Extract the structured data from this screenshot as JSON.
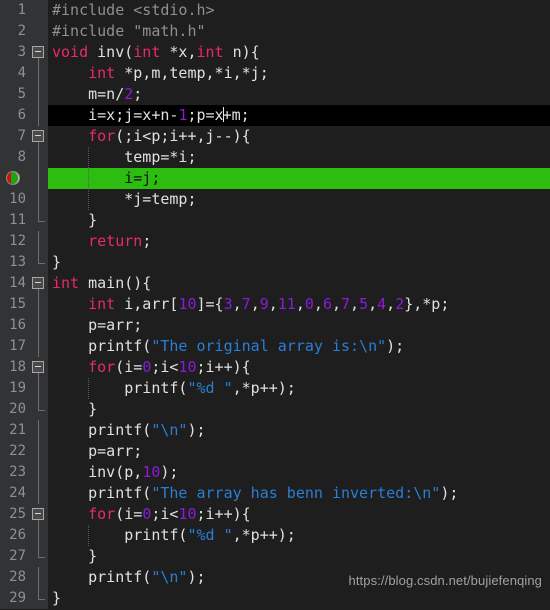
{
  "editor": {
    "language": "C",
    "theme": "dark",
    "colors": {
      "background": "#1e1e1e",
      "gutter_background": "#313335",
      "line_number": "#8a9199",
      "keyword": "#e8296d",
      "number": "#8c1ad9",
      "string": "#2a7ed6",
      "preprocessor": "#8f8f8f",
      "plain_text": "#e0e0e0",
      "current_line": "#000000",
      "execution_line": "#2dbd10"
    },
    "current_line_number": 6,
    "execution_line_number": 9,
    "breakpoint_line_number": 9,
    "caret": {
      "line": 6,
      "after_text": "i=x;j=x+n-1;p=x"
    }
  },
  "watermark": "https://blog.csdn.net/bujiefenqing",
  "lines": [
    {
      "n": "1",
      "indent": 0,
      "fold": "",
      "tokens": [
        {
          "t": "pre",
          "v": "#include <stdio.h>"
        }
      ]
    },
    {
      "n": "2",
      "indent": 0,
      "fold": "",
      "tokens": [
        {
          "t": "pre",
          "v": "#include \"math.h\""
        }
      ]
    },
    {
      "n": "3",
      "indent": 0,
      "fold": "box",
      "tokens": [
        {
          "t": "kw",
          "v": "void"
        },
        {
          "t": "plain",
          "v": " inv("
        },
        {
          "t": "kw",
          "v": "int"
        },
        {
          "t": "plain",
          "v": " *x,"
        },
        {
          "t": "kw",
          "v": "int"
        },
        {
          "t": "plain",
          "v": " n){"
        }
      ]
    },
    {
      "n": "4",
      "indent": 1,
      "fold": "line",
      "tokens": [
        {
          "t": "plain",
          "v": "    "
        },
        {
          "t": "kw",
          "v": "int"
        },
        {
          "t": "plain",
          "v": " *p,m,temp,*i,*j;"
        }
      ]
    },
    {
      "n": "5",
      "indent": 1,
      "fold": "line",
      "tokens": [
        {
          "t": "plain",
          "v": "    m=n/"
        },
        {
          "t": "num",
          "v": "2"
        },
        {
          "t": "plain",
          "v": ";"
        }
      ]
    },
    {
      "n": "6",
      "indent": 1,
      "fold": "line",
      "tokens": [
        {
          "t": "plain",
          "v": "    i=x;j=x+n-"
        },
        {
          "t": "num",
          "v": "1"
        },
        {
          "t": "plain",
          "v": ";p=x"
        },
        {
          "t": "caret",
          "v": ""
        },
        {
          "t": "plain",
          "v": "+m;"
        }
      ]
    },
    {
      "n": "7",
      "indent": 1,
      "fold": "box",
      "tokens": [
        {
          "t": "plain",
          "v": "    "
        },
        {
          "t": "kw",
          "v": "for"
        },
        {
          "t": "plain",
          "v": "(;i<p;i++,j--){"
        }
      ]
    },
    {
      "n": "8",
      "indent": 2,
      "fold": "line",
      "tokens": [
        {
          "t": "plain",
          "v": "        temp=*i;"
        }
      ]
    },
    {
      "n": "9",
      "indent": 2,
      "fold": "line",
      "tokens": [
        {
          "t": "plain",
          "v": "        i=j;"
        }
      ]
    },
    {
      "n": "10",
      "indent": 2,
      "fold": "line",
      "tokens": [
        {
          "t": "plain",
          "v": "        *j=temp;"
        }
      ]
    },
    {
      "n": "11",
      "indent": 1,
      "fold": "end",
      "tokens": [
        {
          "t": "plain",
          "v": "    }"
        }
      ]
    },
    {
      "n": "12",
      "indent": 1,
      "fold": "line",
      "tokens": [
        {
          "t": "plain",
          "v": "    "
        },
        {
          "t": "kw",
          "v": "return"
        },
        {
          "t": "plain",
          "v": ";"
        }
      ]
    },
    {
      "n": "13",
      "indent": 0,
      "fold": "end",
      "tokens": [
        {
          "t": "plain",
          "v": "}"
        }
      ]
    },
    {
      "n": "14",
      "indent": 0,
      "fold": "box",
      "tokens": [
        {
          "t": "kw",
          "v": "int"
        },
        {
          "t": "plain",
          "v": " main(){"
        }
      ]
    },
    {
      "n": "15",
      "indent": 1,
      "fold": "line",
      "tokens": [
        {
          "t": "plain",
          "v": "    "
        },
        {
          "t": "kw",
          "v": "int"
        },
        {
          "t": "plain",
          "v": " i,arr["
        },
        {
          "t": "num",
          "v": "10"
        },
        {
          "t": "plain",
          "v": "]={"
        },
        {
          "t": "num",
          "v": "3"
        },
        {
          "t": "plain",
          "v": ","
        },
        {
          "t": "num",
          "v": "7"
        },
        {
          "t": "plain",
          "v": ","
        },
        {
          "t": "num",
          "v": "9"
        },
        {
          "t": "plain",
          "v": ","
        },
        {
          "t": "num",
          "v": "11"
        },
        {
          "t": "plain",
          "v": ","
        },
        {
          "t": "num",
          "v": "0"
        },
        {
          "t": "plain",
          "v": ","
        },
        {
          "t": "num",
          "v": "6"
        },
        {
          "t": "plain",
          "v": ","
        },
        {
          "t": "num",
          "v": "7"
        },
        {
          "t": "plain",
          "v": ","
        },
        {
          "t": "num",
          "v": "5"
        },
        {
          "t": "plain",
          "v": ","
        },
        {
          "t": "num",
          "v": "4"
        },
        {
          "t": "plain",
          "v": ","
        },
        {
          "t": "num",
          "v": "2"
        },
        {
          "t": "plain",
          "v": "},*p;"
        }
      ]
    },
    {
      "n": "16",
      "indent": 1,
      "fold": "line",
      "tokens": [
        {
          "t": "plain",
          "v": "    p=arr;"
        }
      ]
    },
    {
      "n": "17",
      "indent": 1,
      "fold": "line",
      "tokens": [
        {
          "t": "plain",
          "v": "    printf("
        },
        {
          "t": "str",
          "v": "\"The original array is:\\n\""
        },
        {
          "t": "plain",
          "v": ");"
        }
      ]
    },
    {
      "n": "18",
      "indent": 1,
      "fold": "box",
      "tokens": [
        {
          "t": "plain",
          "v": "    "
        },
        {
          "t": "kw",
          "v": "for"
        },
        {
          "t": "plain",
          "v": "(i="
        },
        {
          "t": "num",
          "v": "0"
        },
        {
          "t": "plain",
          "v": ";i<"
        },
        {
          "t": "num",
          "v": "10"
        },
        {
          "t": "plain",
          "v": ";i++){"
        }
      ]
    },
    {
      "n": "19",
      "indent": 2,
      "fold": "line",
      "tokens": [
        {
          "t": "plain",
          "v": "        printf("
        },
        {
          "t": "str",
          "v": "\"%d \""
        },
        {
          "t": "plain",
          "v": ",*p++);"
        }
      ]
    },
    {
      "n": "20",
      "indent": 1,
      "fold": "end",
      "tokens": [
        {
          "t": "plain",
          "v": "    }"
        }
      ]
    },
    {
      "n": "21",
      "indent": 1,
      "fold": "line",
      "tokens": [
        {
          "t": "plain",
          "v": "    printf("
        },
        {
          "t": "str",
          "v": "\"\\n\""
        },
        {
          "t": "plain",
          "v": ");"
        }
      ]
    },
    {
      "n": "22",
      "indent": 1,
      "fold": "line",
      "tokens": [
        {
          "t": "plain",
          "v": "    p=arr;"
        }
      ]
    },
    {
      "n": "23",
      "indent": 1,
      "fold": "line",
      "tokens": [
        {
          "t": "plain",
          "v": "    inv(p,"
        },
        {
          "t": "num",
          "v": "10"
        },
        {
          "t": "plain",
          "v": ");"
        }
      ]
    },
    {
      "n": "24",
      "indent": 1,
      "fold": "line",
      "tokens": [
        {
          "t": "plain",
          "v": "    printf("
        },
        {
          "t": "str",
          "v": "\"The array has benn inverted:\\n\""
        },
        {
          "t": "plain",
          "v": ");"
        }
      ]
    },
    {
      "n": "25",
      "indent": 1,
      "fold": "box",
      "tokens": [
        {
          "t": "plain",
          "v": "    "
        },
        {
          "t": "kw",
          "v": "for"
        },
        {
          "t": "plain",
          "v": "(i="
        },
        {
          "t": "num",
          "v": "0"
        },
        {
          "t": "plain",
          "v": ";i<"
        },
        {
          "t": "num",
          "v": "10"
        },
        {
          "t": "plain",
          "v": ";i++){"
        }
      ]
    },
    {
      "n": "26",
      "indent": 2,
      "fold": "line",
      "tokens": [
        {
          "t": "plain",
          "v": "        printf("
        },
        {
          "t": "str",
          "v": "\"%d \""
        },
        {
          "t": "plain",
          "v": ",*p++);"
        }
      ]
    },
    {
      "n": "27",
      "indent": 1,
      "fold": "end",
      "tokens": [
        {
          "t": "plain",
          "v": "    }"
        }
      ]
    },
    {
      "n": "28",
      "indent": 1,
      "fold": "line",
      "tokens": [
        {
          "t": "plain",
          "v": "    printf("
        },
        {
          "t": "str",
          "v": "\"\\n\""
        },
        {
          "t": "plain",
          "v": ");"
        }
      ]
    },
    {
      "n": "29",
      "indent": 0,
      "fold": "end",
      "tokens": [
        {
          "t": "plain",
          "v": "}"
        }
      ]
    }
  ]
}
